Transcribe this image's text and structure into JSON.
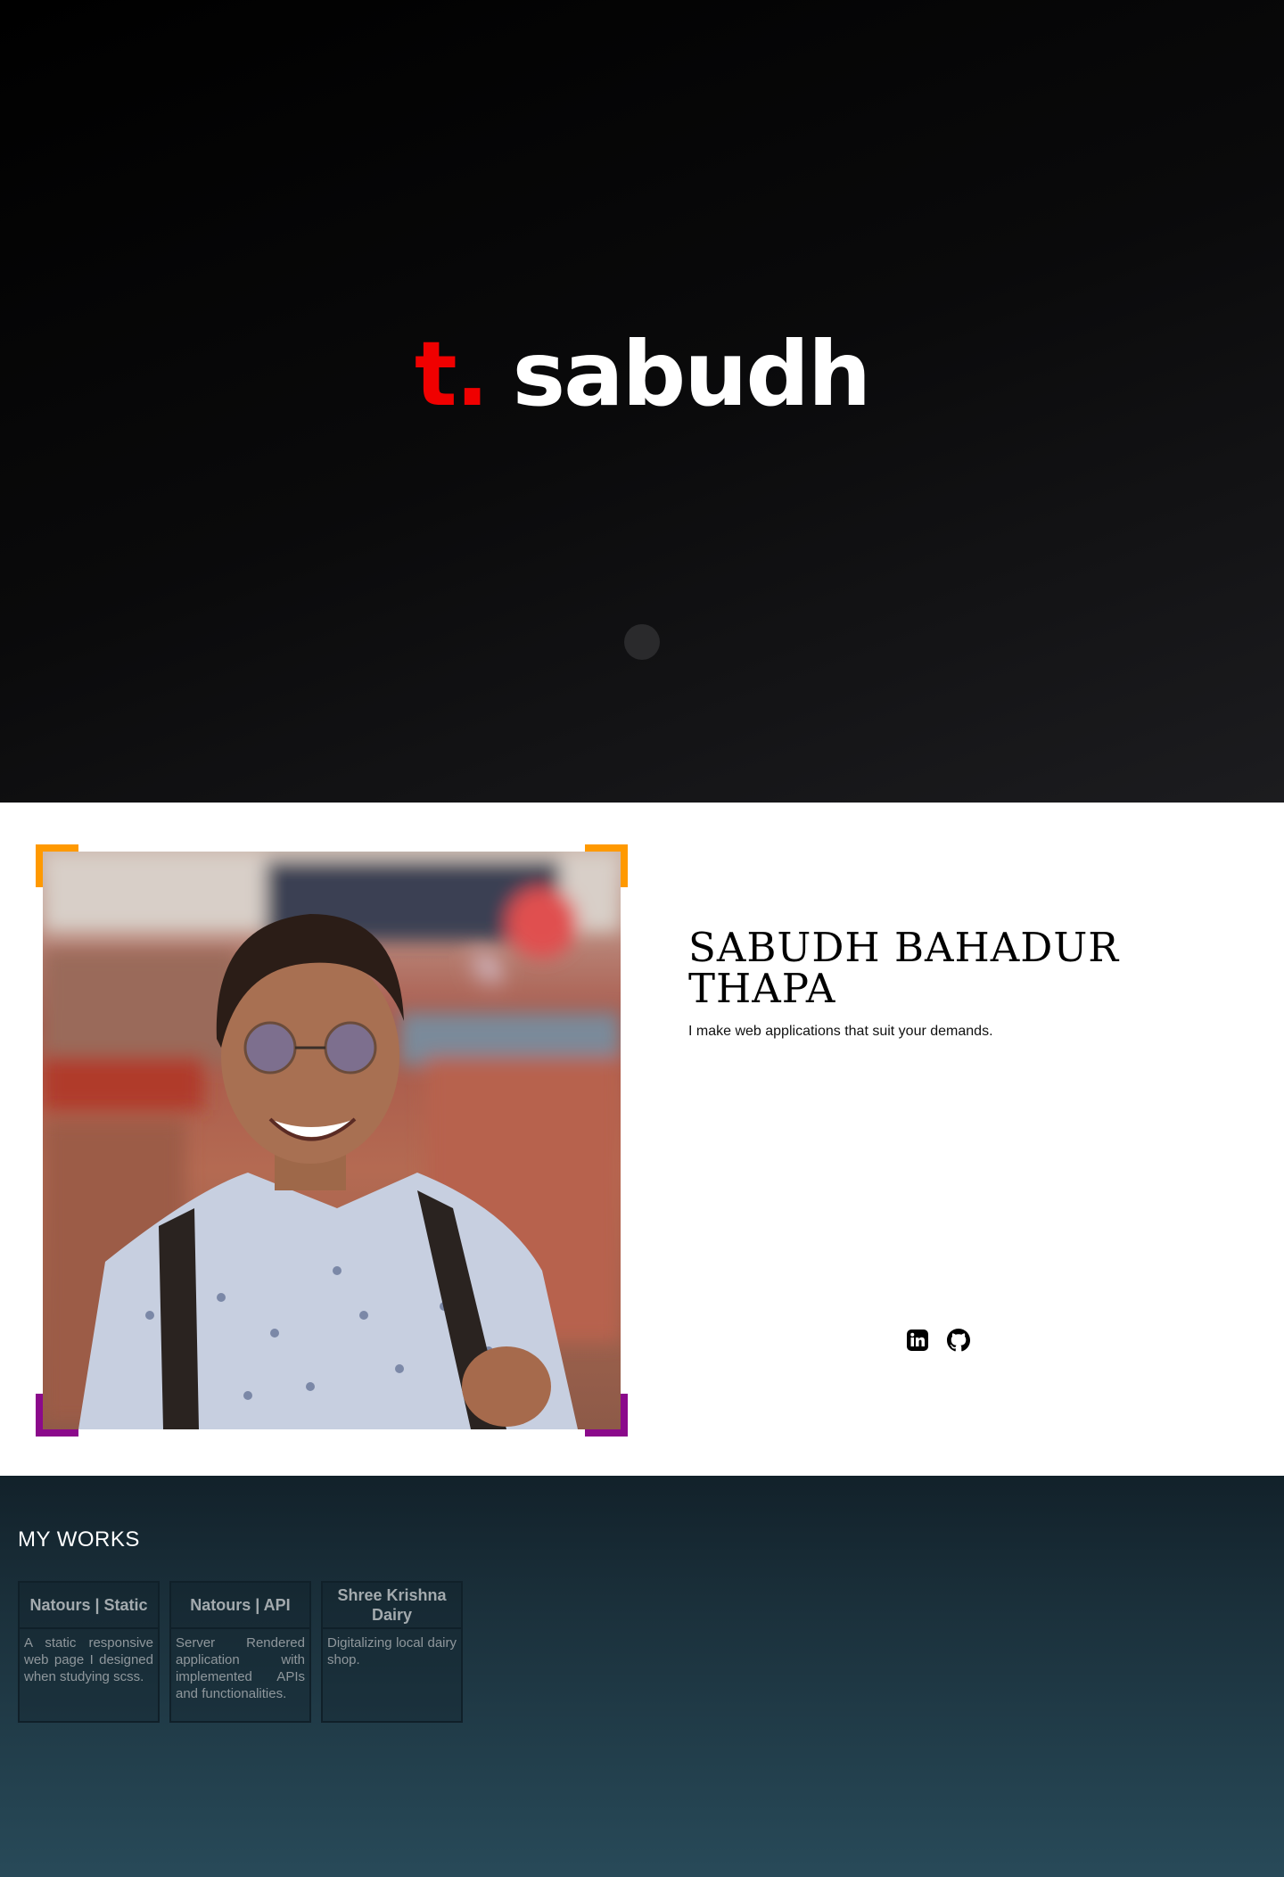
{
  "hero": {
    "logo_mark": "t.",
    "logo_name": "sabudh"
  },
  "about": {
    "name": "SABUDH BAHADUR THAPA",
    "tagline": "I make web applications that suit your demands.",
    "social": [
      {
        "icon": "linkedin-icon"
      },
      {
        "icon": "github-icon"
      }
    ]
  },
  "works": {
    "title": "MY WORKS",
    "projects": [
      {
        "title": "Natours | Static",
        "description": "A static responsive web page I designed when studying scss."
      },
      {
        "title": "Natours | API",
        "description": "Server Rendered application with implemented APIs and functionalities."
      },
      {
        "title": "Shree Krishna Dairy",
        "description": "Digitalizing local dairy shop."
      }
    ]
  },
  "colors": {
    "accent_red": "#f00000",
    "corner_orange": "#ff9900",
    "corner_purple": "#8b0a8b",
    "works_bg_top": "#12212a",
    "works_bg_bottom": "#284a59"
  }
}
